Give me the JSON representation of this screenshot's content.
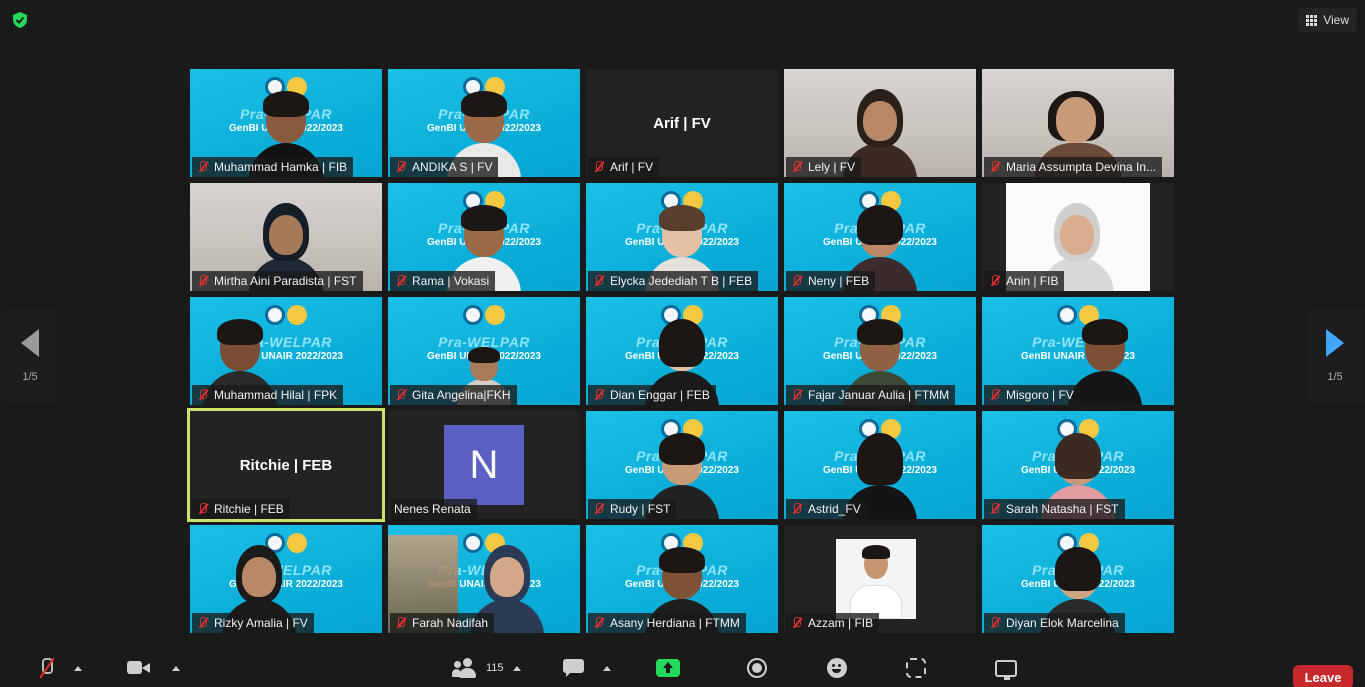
{
  "header": {
    "view_label": "View"
  },
  "navigation": {
    "page_left": "1/5",
    "page_right": "1/5"
  },
  "banner": {
    "title": "Pra-WELPAR",
    "subtitle": "GenBI UNAIR 2022/2023"
  },
  "tiles": [
    {
      "name": "Muhammad Hamka | FIB",
      "muted": true
    },
    {
      "name": "ANDIKA S | FV",
      "muted": true
    },
    {
      "name": "Arif | FV",
      "muted": true,
      "center_label": "Arif | FV"
    },
    {
      "name": "Lely | FV",
      "muted": true
    },
    {
      "name": "Maria Assumpta Devina In...",
      "muted": true
    },
    {
      "name": "Mirtha Aini Paradista | FST",
      "muted": true
    },
    {
      "name": "Rama | Vokasi",
      "muted": true
    },
    {
      "name": "Elycka Jedediah T B | FEB",
      "muted": true
    },
    {
      "name": "Neny | FEB",
      "muted": true
    },
    {
      "name": "Anin | FIB",
      "muted": true
    },
    {
      "name": "Muhammad Hilal | FPK",
      "muted": true
    },
    {
      "name": "Gita Angelina|FKH",
      "muted": true
    },
    {
      "name": "Dian Enggar | FEB",
      "muted": true
    },
    {
      "name": "Fajar Januar Aulia | FTMM",
      "muted": true
    },
    {
      "name": "Misgoro | FV",
      "muted": true
    },
    {
      "name": "Ritchie | FEB",
      "muted": true,
      "center_label": "Ritchie | FEB"
    },
    {
      "name": "Nenes Renata",
      "muted": false,
      "avatar_letter": "N"
    },
    {
      "name": "Rudy | FST",
      "muted": true
    },
    {
      "name": "Astrid_FV",
      "muted": true
    },
    {
      "name": "Sarah  Natasha | FST",
      "muted": true
    },
    {
      "name": "Rizky Amalia | FV",
      "muted": true
    },
    {
      "name": "Farah Nadifah",
      "muted": true
    },
    {
      "name": "Asany Herdiana | FTMM",
      "muted": true
    },
    {
      "name": "Azzam | FIB",
      "muted": true
    },
    {
      "name": "Diyan Elok Marcelina",
      "muted": true
    }
  ],
  "toolbar": {
    "participants_count": "115",
    "leave_label": "Leave"
  },
  "colors": {
    "background": "#1a1a1a",
    "tile_banner": "#0aaed8",
    "active_speaker_border": "#c8e36a",
    "leave_button": "#c7282e",
    "share_screen": "#23d959",
    "avatar_n": "#5b61c4",
    "muted_icon": "#e0302e"
  }
}
